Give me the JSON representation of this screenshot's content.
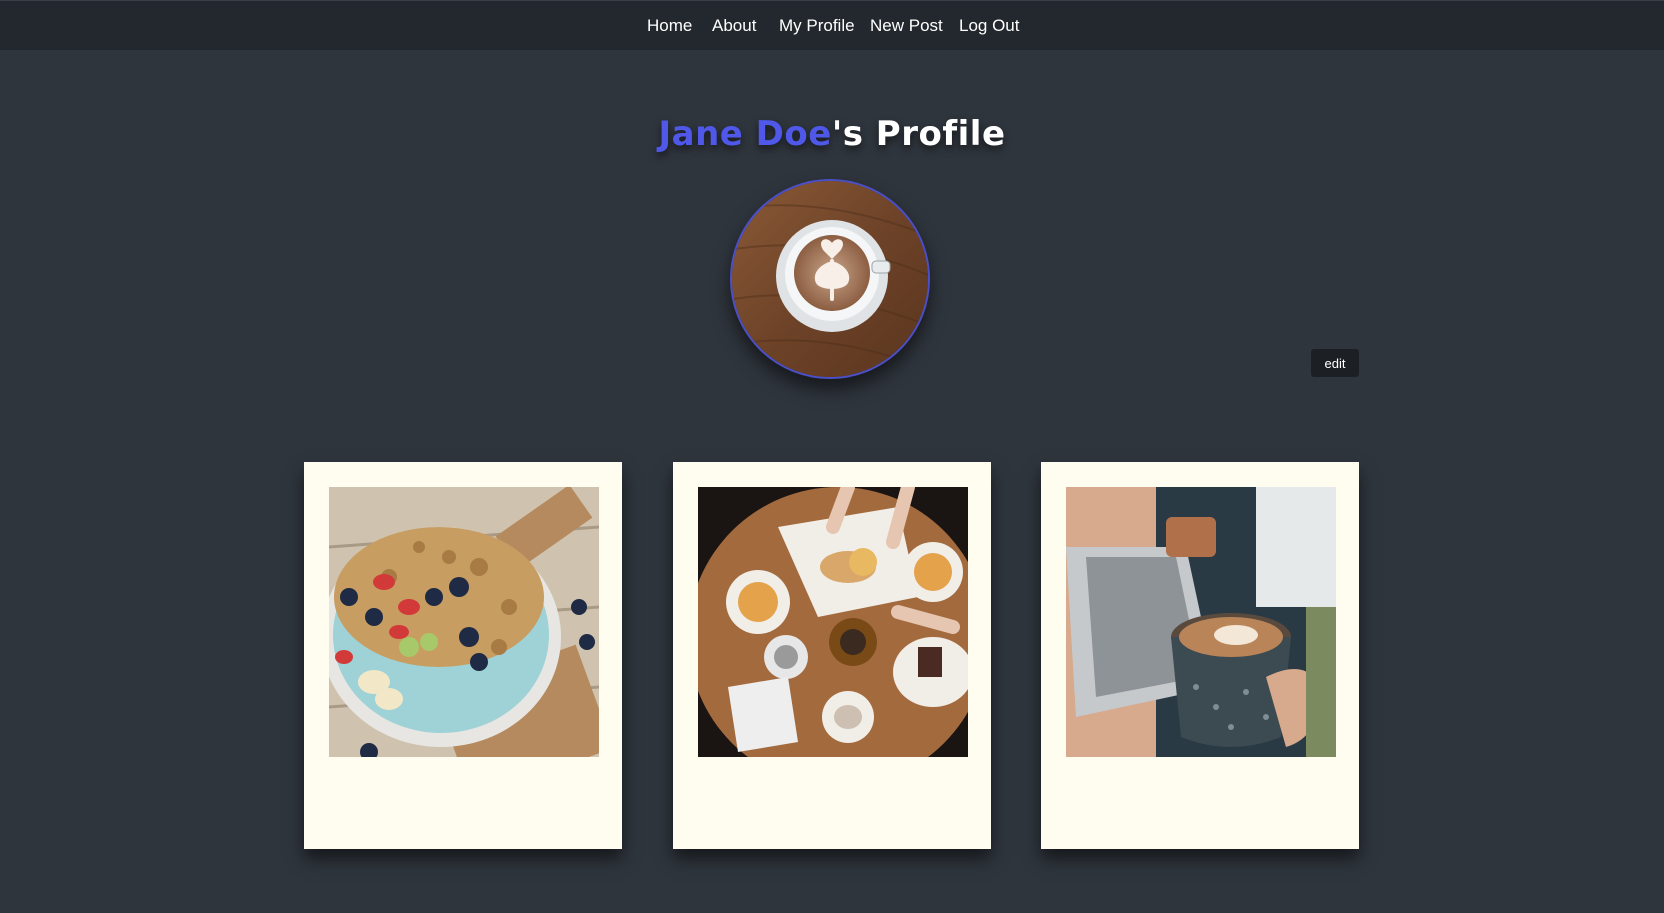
{
  "nav": {
    "items": [
      {
        "label": "Home"
      },
      {
        "label": "About"
      },
      {
        "label": "My Profile"
      },
      {
        "label": "New Post"
      },
      {
        "label": "Log Out"
      }
    ]
  },
  "profile": {
    "name": "Jane Doe",
    "title_suffix": "'s Profile",
    "avatar_icon": "latte-art-photo"
  },
  "actions": {
    "edit_label": "edit"
  },
  "posts": [
    {
      "photo": "granola-berry-bowl-photo"
    },
    {
      "photo": "coffee-table-brunch-photo"
    },
    {
      "photo": "latte-pour-photo"
    }
  ],
  "colors": {
    "background": "#2f353d",
    "navbar": "#23282e",
    "name_accent": "#4f58e8",
    "card": "#fffdf0",
    "edit_button": "#1c2025"
  }
}
